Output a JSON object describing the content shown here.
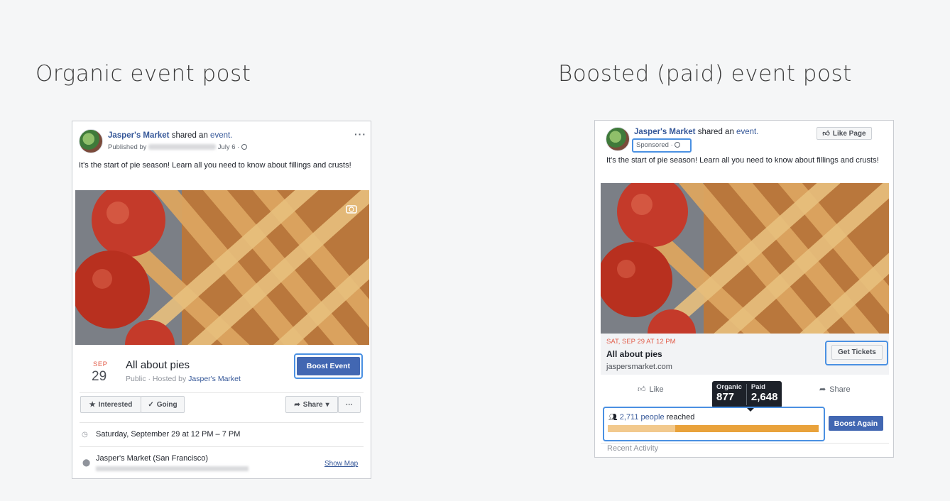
{
  "headings": {
    "left": "Organic event post",
    "right": "Boosted (paid) event post"
  },
  "organic": {
    "page_name": "Jasper's Market",
    "shared_text": "shared an",
    "shared_link": "event.",
    "published_by": "Published by",
    "date": "July 6 ·",
    "post_text": "It's the start of pie season! Learn all you need to know about fillings and crusts!",
    "event_month": "SEP",
    "event_day": "29",
    "event_title": "All about pies",
    "event_sub_prefix": "Public · Hosted by",
    "event_host": "Jasper's Market",
    "boost_label": "Boost Event",
    "interested_label": "Interested",
    "going_label": "Going",
    "share_label": "Share",
    "date_time": "Saturday, September 29 at 12 PM – 7 PM",
    "location": "Jasper's Market (San Francisco)",
    "show_map": "Show Map"
  },
  "boosted": {
    "page_name": "Jasper's Market",
    "shared_text": "shared an",
    "shared_link": "event.",
    "like_page": "Like Page",
    "sponsored": "Sponsored ·",
    "post_text": "It's the start of pie season! Learn all you need to know about fillings and crusts!",
    "cta_date": "SAT, SEP 29 AT 12 PM",
    "cta_title": "All about pies",
    "cta_url": "jaspersmarket.com",
    "get_tickets": "Get Tickets",
    "like_label": "Like",
    "share_label": "Share",
    "tooltip": {
      "organic_label": "Organic",
      "organic_value": "877",
      "paid_label": "Paid",
      "paid_value": "2,648"
    },
    "reach_count": "2,711 people",
    "reach_suffix": "reached",
    "boost_again": "Boost Again",
    "recent_activity": "Recent Activity",
    "organic_fraction": 0.32
  },
  "colors": {
    "link": "#365899",
    "boost_button": "#4267b2",
    "highlight": "#4a90e2",
    "date_red": "#e25d4a",
    "paid_bar": "#e9a23b",
    "organic_bar": "#f2c98d"
  },
  "icons": [
    "camera-icon",
    "globe-icon",
    "star-icon",
    "check-icon",
    "share-arrow-icon",
    "clock-icon",
    "pin-icon",
    "thumbs-up-icon",
    "people-icon",
    "more-dots-icon"
  ]
}
